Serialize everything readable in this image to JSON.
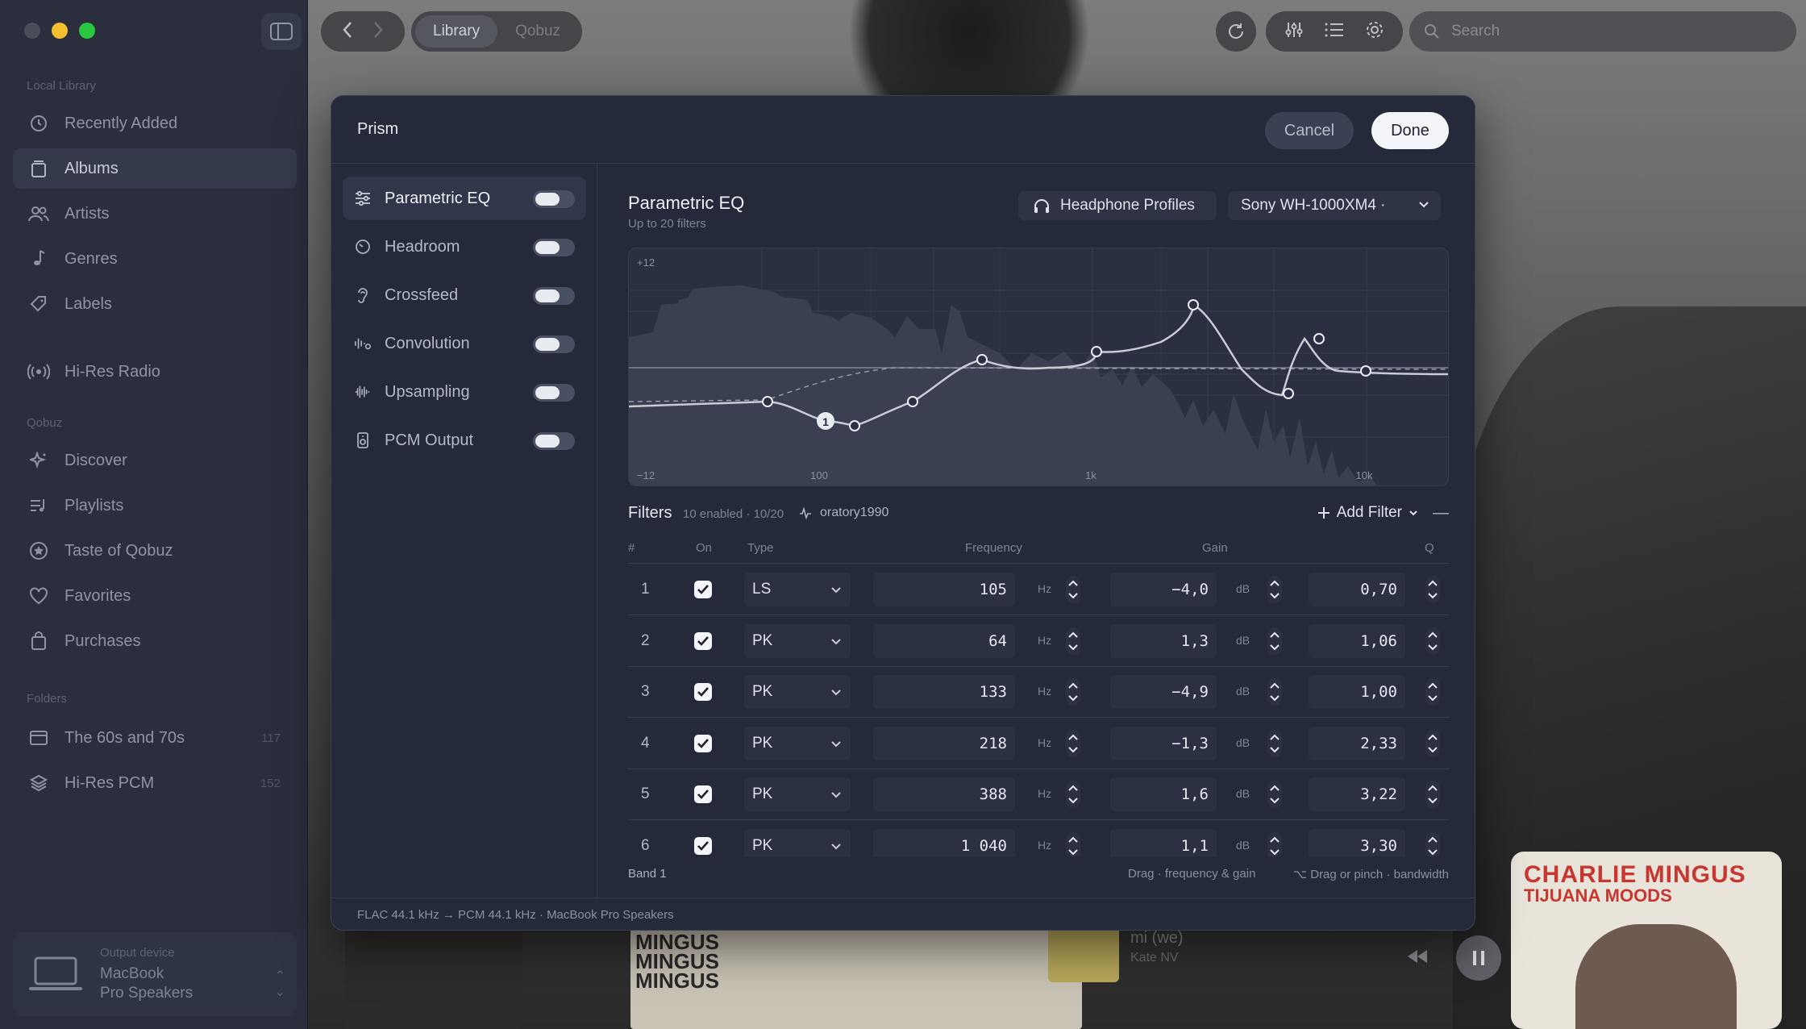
{
  "sidebar": {
    "local_library_label": "Local Library",
    "local_items": [
      {
        "label": "Recently Added",
        "icon": "clock-icon"
      },
      {
        "label": "Albums",
        "icon": "album-icon"
      },
      {
        "label": "Artists",
        "icon": "people-icon"
      },
      {
        "label": "Genres",
        "icon": "music-note-icon"
      },
      {
        "label": "Labels",
        "icon": "tag-icon"
      }
    ],
    "radio_label": "Hi-Res Radio",
    "qobuz_label": "Qobuz",
    "qobuz_items": [
      {
        "label": "Discover",
        "icon": "sparkle-icon"
      },
      {
        "label": "Playlists",
        "icon": "playlist-icon"
      },
      {
        "label": "Taste of Qobuz",
        "icon": "star-icon"
      },
      {
        "label": "Favorites",
        "icon": "heart-icon"
      },
      {
        "label": "Purchases",
        "icon": "bag-icon"
      }
    ],
    "folders_label": "Folders",
    "folders": [
      {
        "label": "The 60s and 70s",
        "count": "117"
      },
      {
        "label": "Hi-Res PCM",
        "count": "152"
      }
    ],
    "output": {
      "small": "Output device",
      "name_line1": "MacBook",
      "name_line2": "Pro Speakers"
    }
  },
  "topbar": {
    "tab_library": "Library",
    "tab_qobuz": "Qobuz",
    "search_placeholder": "Search"
  },
  "background": {
    "album_title": "CHARLIE MINGUS",
    "album_sub": "TIJUANA MOODS",
    "now_playing_title": "mi (we)",
    "now_playing_artist": "Kate NV",
    "strip_mingus": "MINGUS MINGUS MINGUS"
  },
  "modal": {
    "title": "Prism",
    "cancel": "Cancel",
    "done": "Done",
    "effects": [
      {
        "label": "Parametric EQ",
        "icon": "sliders-icon"
      },
      {
        "label": "Headroom",
        "icon": "gauge-icon"
      },
      {
        "label": "Crossfeed",
        "icon": "ear-icon"
      },
      {
        "label": "Convolution",
        "icon": "convolution-icon"
      },
      {
        "label": "Upsampling",
        "icon": "waveform-icon"
      },
      {
        "label": "PCM Output",
        "icon": "speaker-icon"
      }
    ],
    "peq": {
      "title": "Parametric EQ",
      "subtitle": "Up to 20 filters",
      "headphone_profiles": "Headphone Profiles",
      "headphone_selected": "Sony WH-1000XM4 ·"
    },
    "graph": {
      "y_top": "+12",
      "y_bottom": "−12",
      "x_100": "100",
      "x_1k": "1k",
      "x_10k": "10k",
      "selected_band": "1"
    },
    "filters": {
      "title": "Filters",
      "meta": "10 enabled · 10/20",
      "preset": "oratory1990",
      "add": "Add Filter",
      "collapse": "—",
      "headers": {
        "num": "#",
        "on": "On",
        "type": "Type",
        "freq": "Frequency",
        "gain": "Gain",
        "q": "Q"
      },
      "unit_hz": "Hz",
      "unit_db": "dB",
      "rows": [
        {
          "n": "1",
          "type": "LS",
          "freq": "105",
          "gain": "−4,0",
          "q": "0,70"
        },
        {
          "n": "2",
          "type": "PK",
          "freq": "64",
          "gain": "1,3",
          "q": "1,06"
        },
        {
          "n": "3",
          "type": "PK",
          "freq": "133",
          "gain": "−4,9",
          "q": "1,00"
        },
        {
          "n": "4",
          "type": "PK",
          "freq": "218",
          "gain": "−1,3",
          "q": "2,33"
        },
        {
          "n": "5",
          "type": "PK",
          "freq": "388",
          "gain": "1,6",
          "q": "3,22"
        },
        {
          "n": "6",
          "type": "PK",
          "freq": "1 040",
          "gain": "1,1",
          "q": "3,30"
        }
      ]
    },
    "footer": {
      "band": "Band 1",
      "hint1": "Drag · frequency & gain",
      "hint2": "⌥ Drag or pinch · bandwidth"
    },
    "status": "FLAC 44.1 kHz → PCM 44.1 kHz · MacBook Pro Speakers"
  }
}
